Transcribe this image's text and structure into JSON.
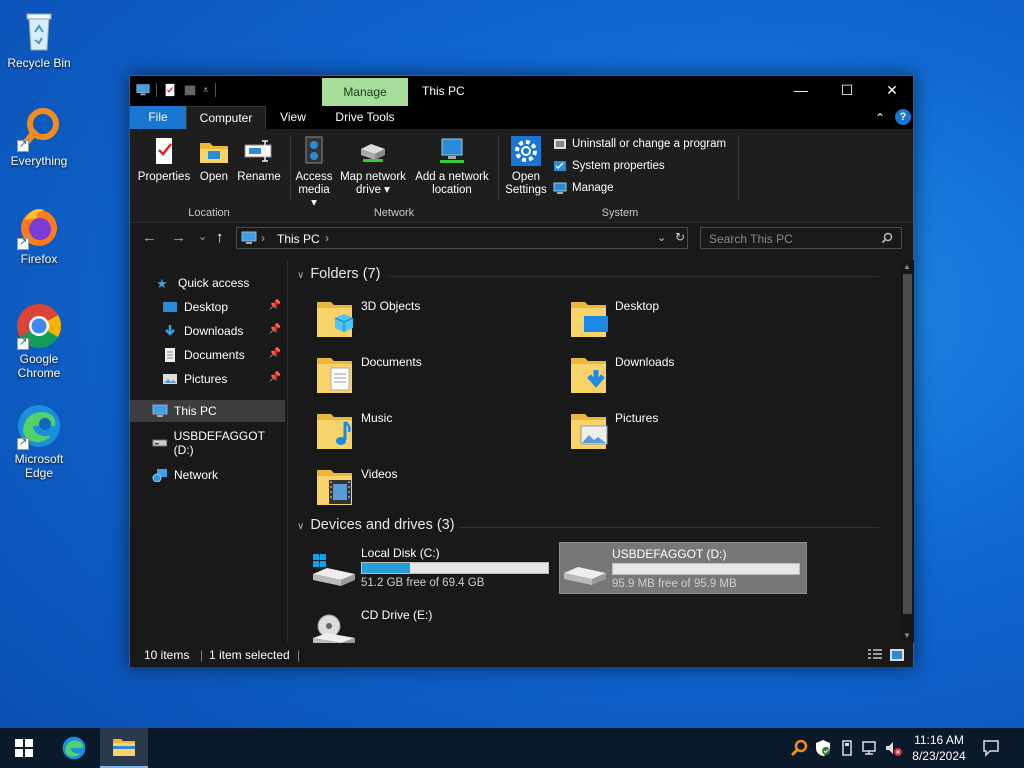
{
  "desktop": {
    "icons": [
      {
        "label": "Recycle Bin",
        "icon": "recycle-bin-icon"
      },
      {
        "label": "Everything",
        "icon": "everything-search-icon"
      },
      {
        "label": "Firefox",
        "icon": "firefox-icon"
      },
      {
        "label": "Google Chrome",
        "icon": "chrome-icon"
      },
      {
        "label": "Microsoft Edge",
        "icon": "edge-icon"
      }
    ]
  },
  "window": {
    "title": "This PC",
    "context_tab": "Manage",
    "controls": {
      "minimize": "—",
      "maximize": "☐",
      "close": "✕"
    },
    "tabs": {
      "file": "File",
      "computer": "Computer",
      "view": "View",
      "drive_tools": "Drive Tools"
    },
    "help": "?",
    "collapse": "⌃"
  },
  "ribbon": {
    "location": {
      "label": "Location",
      "properties": "Properties",
      "open": "Open",
      "rename": "Rename"
    },
    "network": {
      "label": "Network",
      "access_media_1": "Access",
      "access_media_2": "media ▾",
      "map_drive_1": "Map network",
      "map_drive_2": "drive ▾",
      "add_location_1": "Add a network",
      "add_location_2": "location"
    },
    "system": {
      "label": "System",
      "open_settings_1": "Open",
      "open_settings_2": "Settings",
      "uninstall": "Uninstall or change a program",
      "system_properties": "System properties",
      "manage": "Manage"
    }
  },
  "address": {
    "back": "←",
    "forward": "→",
    "recent": "⌄",
    "up": "↑",
    "path": "This PC",
    "sep": "›",
    "dropdown": "⌄",
    "refresh": "↻",
    "search_placeholder": "Search This PC"
  },
  "nav": {
    "quick_access": "Quick access",
    "desktop": "Desktop",
    "downloads": "Downloads",
    "documents": "Documents",
    "pictures": "Pictures",
    "this_pc": "This PC",
    "usb": "USBDEFAGGOT (D:)",
    "network": "Network",
    "pin": "📌"
  },
  "content": {
    "folders_header": "Folders (7)",
    "folders": [
      "3D Objects",
      "Desktop",
      "Documents",
      "Downloads",
      "Music",
      "Pictures",
      "Videos"
    ],
    "drives_header": "Devices and drives (3)",
    "drives": [
      {
        "name": "Local Disk (C:)",
        "free": "51.2 GB free of 69.4 GB",
        "used_fraction": 0.26
      },
      {
        "name": "USBDEFAGGOT (D:)",
        "free": "95.9 MB free of 95.9 MB",
        "used_fraction": 0.0
      },
      {
        "name": "CD Drive (E:)"
      }
    ]
  },
  "status": {
    "items": "10 items",
    "selected": "1 item selected"
  },
  "taskbar": {
    "time": "11:16 AM",
    "date": "8/23/2024"
  },
  "colors": {
    "accent": "#1976d2",
    "manage_tab": "#a6dd9a",
    "drive_bar": "#26a0da"
  }
}
